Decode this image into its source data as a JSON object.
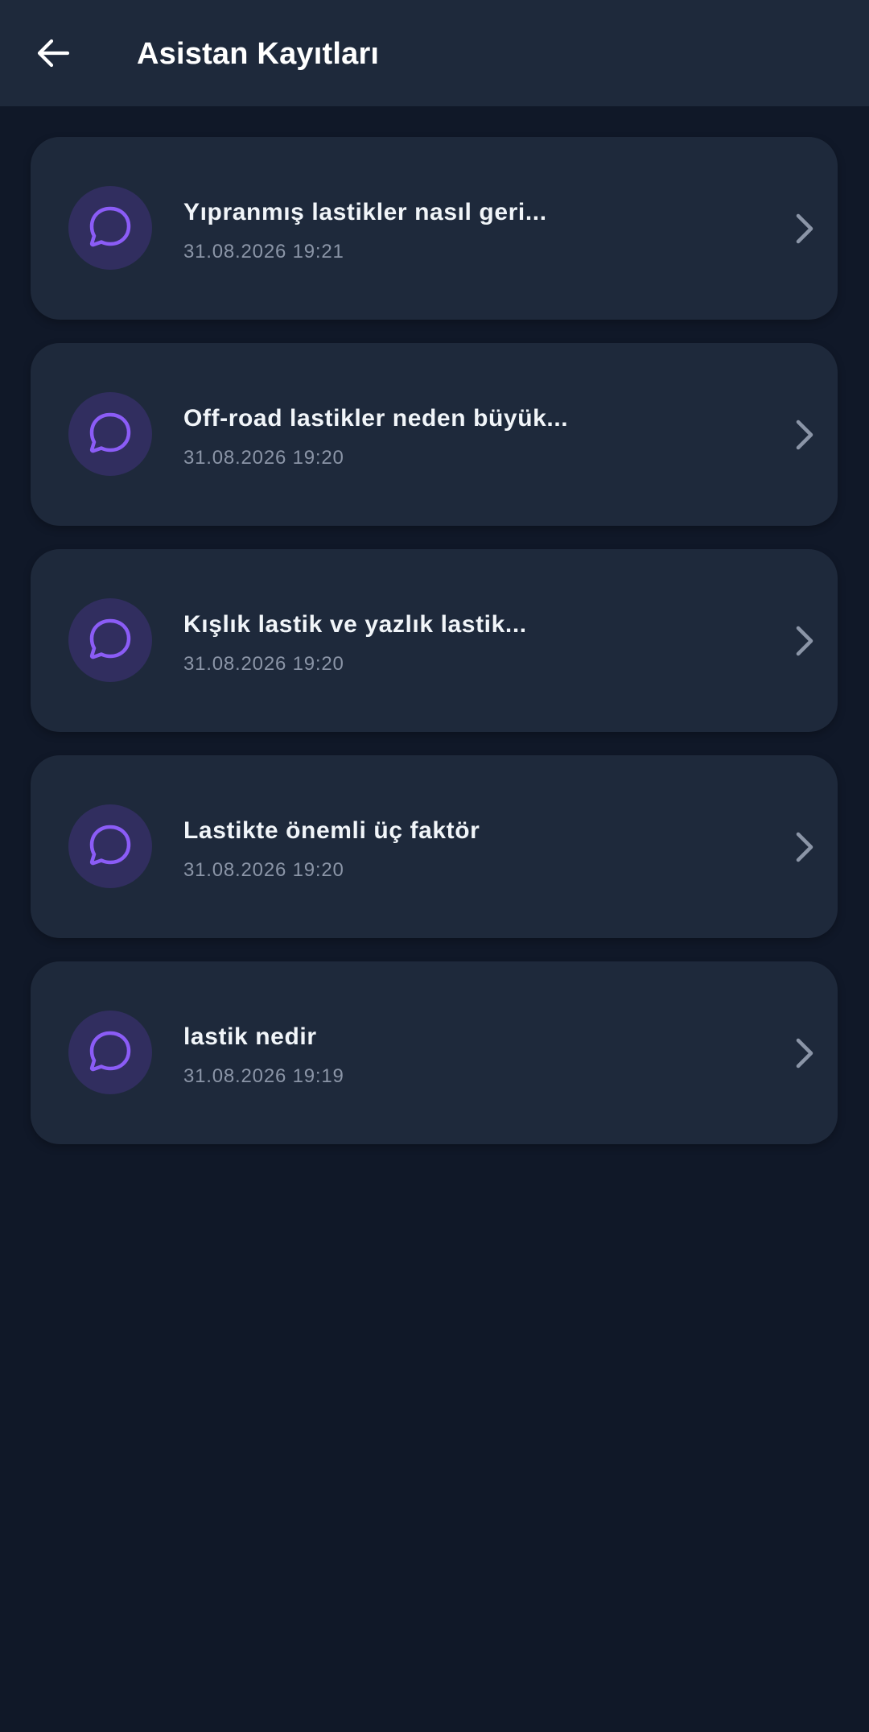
{
  "header": {
    "title": "Asistan Kayıtları",
    "back_icon": "arrow-left-icon"
  },
  "colors": {
    "background": "#101828",
    "surface": "#1e293b",
    "accent": "#8b5cf6",
    "icon_bg": "#312e5f",
    "subtext": "#8b95a7"
  },
  "records": [
    {
      "title": "Yıpranmış lastikler nasıl geri...",
      "date": "31.08.2026 19:21",
      "icon": "chat-bubble-icon"
    },
    {
      "title": "Off-road lastikler neden büyük...",
      "date": "31.08.2026 19:20",
      "icon": "chat-bubble-icon"
    },
    {
      "title": "Kışlık lastik ve yazlık lastik...",
      "date": "31.08.2026 19:20",
      "icon": "chat-bubble-icon"
    },
    {
      "title": "Lastikte önemli üç faktör",
      "date": "31.08.2026 19:20",
      "icon": "chat-bubble-icon"
    },
    {
      "title": "lastik nedir",
      "date": "31.08.2026 19:19",
      "icon": "chat-bubble-icon"
    }
  ]
}
